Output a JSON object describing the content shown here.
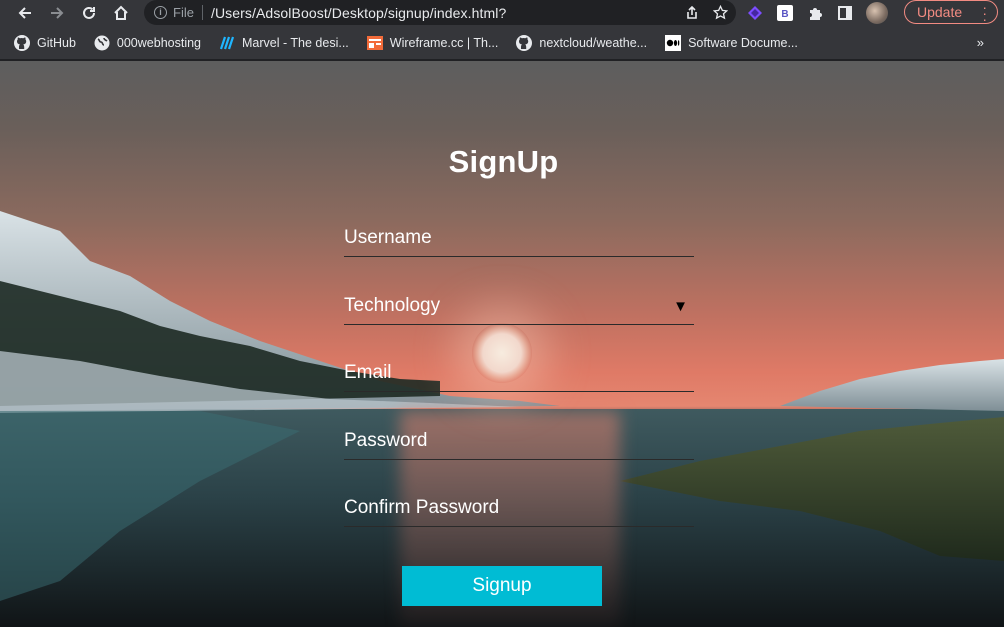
{
  "browser": {
    "omnibox": {
      "scheme_label": "File",
      "url": "/Users/AdsolBoost/Desktop/signup/index.html?"
    },
    "update_label": "Update",
    "bookmarks": [
      {
        "label": "GitHub",
        "icon": "github-icon"
      },
      {
        "label": "000webhosting",
        "icon": "globe-icon"
      },
      {
        "label": "Marvel - The desi...",
        "icon": "marvel-icon"
      },
      {
        "label": "Wireframe.cc | Th...",
        "icon": "wireframe-icon"
      },
      {
        "label": "nextcloud/weathe...",
        "icon": "github-icon"
      },
      {
        "label": "Software Docume...",
        "icon": "medium-icon"
      }
    ],
    "more_bookmarks": "»"
  },
  "signup": {
    "title": "SignUp",
    "username_placeholder": "Username",
    "technology_selected": "Technology",
    "email_placeholder": "Email",
    "password_placeholder": "Password",
    "confirm_password_placeholder": "Confirm Password",
    "submit_label": "Signup"
  },
  "colors": {
    "accent": "#00bcd4",
    "update_pill": "#f28b82"
  }
}
